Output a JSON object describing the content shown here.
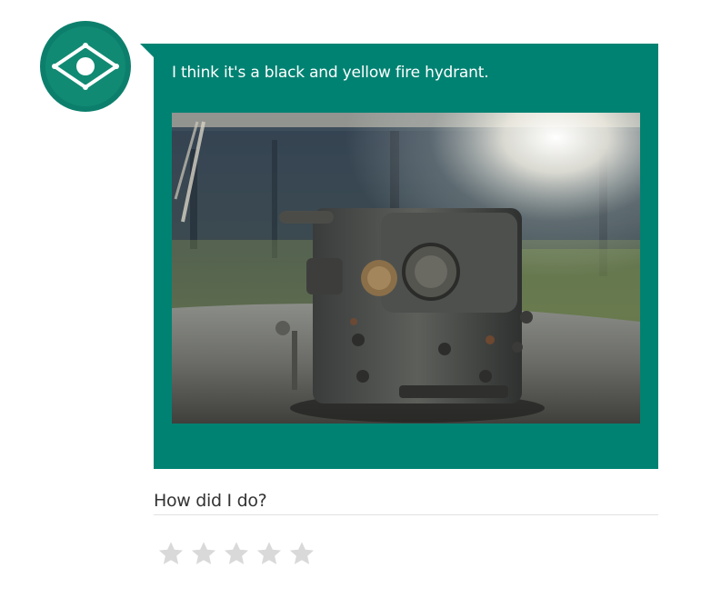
{
  "message": {
    "text": "I think it's a black and yellow fire hydrant."
  },
  "feedback": {
    "prompt": "How did I do?",
    "stars": 5,
    "selected": 0
  },
  "colors": {
    "accent": "#008272",
    "avatar": "#0c7f6c",
    "star_empty": "#d9d9d9"
  },
  "icons": {
    "avatar": "eye-icon",
    "rating": "star-icon"
  }
}
